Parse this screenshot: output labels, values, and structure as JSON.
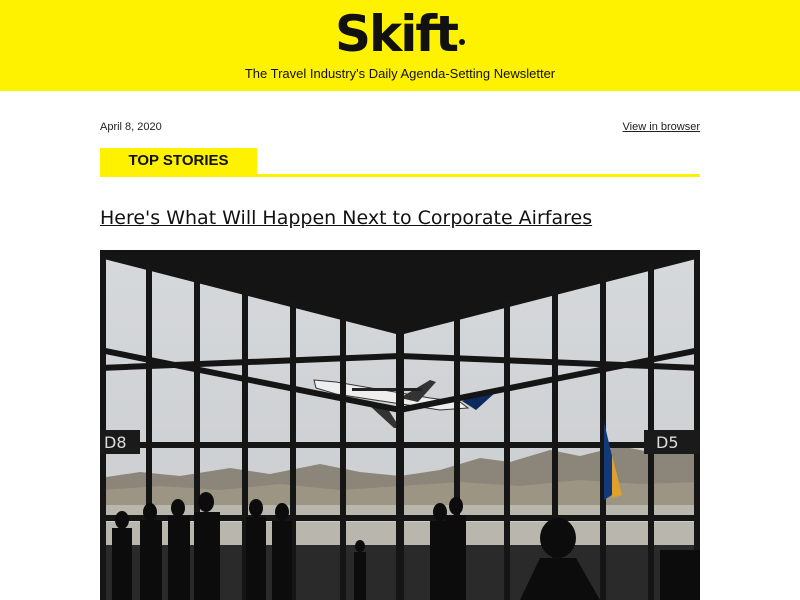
{
  "header": {
    "logo_text": "Skift",
    "tagline": "The Travel Industry's Daily Agenda-Setting Newsletter",
    "background_color": "#fff200"
  },
  "meta": {
    "date": "April 8, 2020",
    "view_in_browser": "View in browser"
  },
  "section": {
    "label": "TOP STORIES"
  },
  "story": {
    "headline": "Here's What Will Happen Next to Corporate Airfares",
    "image": {
      "subject": "airport-terminal-window-airplane-takeoff",
      "gate_left": "D8",
      "gate_right": "D5"
    }
  }
}
